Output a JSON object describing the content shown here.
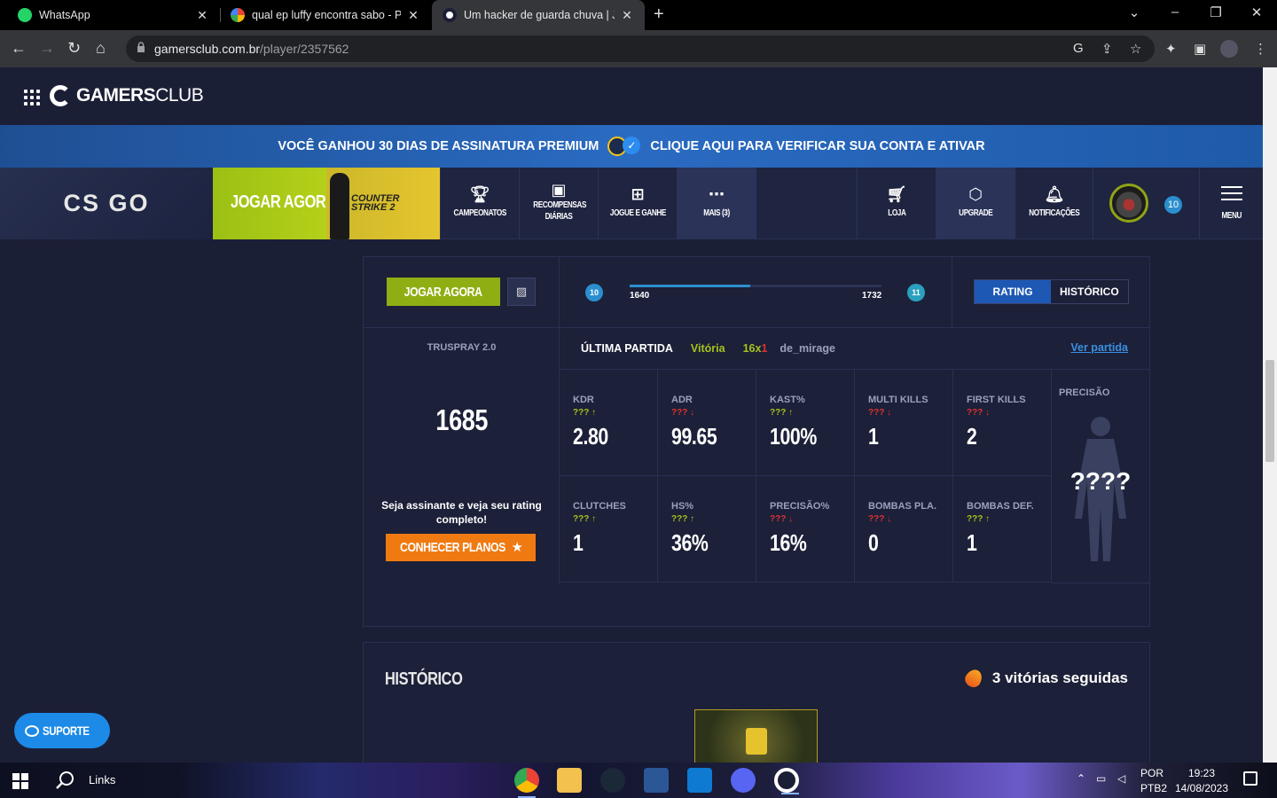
{
  "browser": {
    "tabs": [
      {
        "title": "WhatsApp",
        "active": false
      },
      {
        "title": "qual ep luffy encontra sabo - Pes",
        "active": false
      },
      {
        "title": "Um hacker de guarda chuva | Jog",
        "active": true
      }
    ],
    "url_domain": "gamersclub.com.br",
    "url_path": "/player/2357562"
  },
  "site": {
    "logo_gamers": "GAMERS",
    "logo_club": "CLUB",
    "promo_left": "VOCÊ GANHOU 30 DIAS DE ASSINATURA PREMIUM",
    "promo_right": "CLIQUE AQUI PARA VERIFICAR SUA CONTA E ATIVAR",
    "game_logo": "CS GO",
    "jogar_agora": "JOGAR AGORA",
    "cs2_line1": "COUNTER",
    "cs2_line2": "STRIKE 2",
    "nav": [
      {
        "label": "CAMPEONATOS",
        "icon": "trophy-icon"
      },
      {
        "label": "RECOMPENSAS DIÁRIAS",
        "icon": "calendar-icon"
      },
      {
        "label": "JOGUE E GANHE",
        "icon": "gift-icon"
      },
      {
        "label": "MAIS (3)",
        "icon": "more-icon"
      },
      {
        "label": "LOJA",
        "icon": "cart-icon"
      },
      {
        "label": "UPGRADE",
        "icon": "upgrade-icon"
      },
      {
        "label": "NOTIFICAÇÕES",
        "icon": "bell-icon"
      }
    ],
    "player_level": "10",
    "menu_label": "MENU"
  },
  "profile": {
    "jogar_agora": "JOGAR AGORA",
    "level_current": "10",
    "level_next": "11",
    "rating_min": "1640",
    "rating_max": "1732",
    "progress_fraction": 0.48,
    "tab_rating": "RATING",
    "tab_historico": "HISTÓRICO",
    "truspray_title": "TRUSPRAY 2.0",
    "rating_value": "1685",
    "subscribe_msg": "Seja assinante e veja seu rating completo!",
    "planos_btn": "CONHECER PLANOS",
    "last_match_title": "ÚLTIMA PARTIDA",
    "last_match_result": "Vitória",
    "last_match_score_a": "16x",
    "last_match_score_b": "1",
    "last_match_map": "de_mirage",
    "ver_partida": "Ver partida",
    "stats": [
      {
        "label": "KDR",
        "cmp": "???",
        "dir": "up",
        "value": "2.80"
      },
      {
        "label": "ADR",
        "cmp": "???",
        "dir": "down",
        "value": "99.65"
      },
      {
        "label": "KAST%",
        "cmp": "???",
        "dir": "up",
        "value": "100%"
      },
      {
        "label": "MULTI KILLS",
        "cmp": "???",
        "dir": "down",
        "value": "1"
      },
      {
        "label": "FIRST KILLS",
        "cmp": "???",
        "dir": "down",
        "value": "2"
      },
      {
        "label": "CLUTCHES",
        "cmp": "???",
        "dir": "up",
        "value": "1"
      },
      {
        "label": "HS%",
        "cmp": "???",
        "dir": "up",
        "value": "36%"
      },
      {
        "label": "PRECISÃO%",
        "cmp": "???",
        "dir": "down",
        "value": "16%"
      },
      {
        "label": "BOMBAS PLA.",
        "cmp": "???",
        "dir": "down",
        "value": "0"
      },
      {
        "label": "BOMBAS DEF.",
        "cmp": "???",
        "dir": "up",
        "value": "1"
      }
    ],
    "precisao_label": "PRECISÃO",
    "precisao_value": "????"
  },
  "historico": {
    "title": "HISTÓRICO",
    "streak": "3 vitórias seguidas"
  },
  "suporte": "SUPORTE",
  "taskbar": {
    "search_label": "Links",
    "lang_1": "POR",
    "lang_2": "PTB2",
    "time": "19:23",
    "date": "14/08/2023"
  }
}
